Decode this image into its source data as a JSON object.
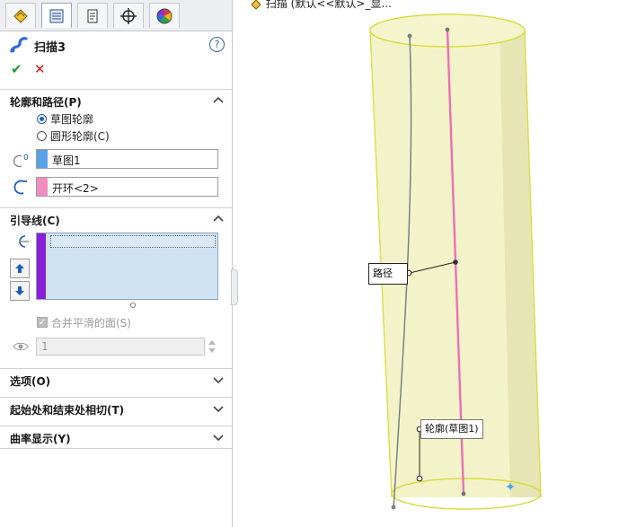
{
  "tabs": [
    {
      "name": "feature-manager-icon"
    },
    {
      "name": "property-manager-icon",
      "active": true
    },
    {
      "name": "configuration-manager-icon"
    },
    {
      "name": "dimxpert-manager-icon"
    },
    {
      "name": "display-manager-icon"
    }
  ],
  "feature": {
    "title": "扫描3",
    "help": "?",
    "ok": "✔",
    "cancel": "✕"
  },
  "sections": {
    "profile_path": {
      "title": "轮廓和路径(P)",
      "radio_sketch": "草图轮廓",
      "radio_circle": "圆形轮廓(C)",
      "profile_value": "草图1",
      "path_value": "开环<2>"
    },
    "guides": {
      "title": "引导线(C)",
      "merge_label": "合并平滑的面(S)",
      "spin_value": "1"
    },
    "options": {
      "title": "选项(O)"
    },
    "tangency": {
      "title": "起始处和结束处相切(T)"
    },
    "curvature": {
      "title": "曲率显示(Y)"
    }
  },
  "viewport": {
    "breadcrumb": "扫描 (默认<<默认>_显...",
    "callout_path": "路径",
    "callout_profile": "轮廓(草图1)"
  },
  "colors": {
    "profile_swatch": "#5aa2e6",
    "path_swatch": "#f08cc0",
    "guide_bar": "#8a1dd6",
    "cylinder_fill": "#f3f3c9",
    "cylinder_edge": "#d8dc3c",
    "path_line": "#ee6fb4",
    "guide_line": "#7a7f86"
  }
}
